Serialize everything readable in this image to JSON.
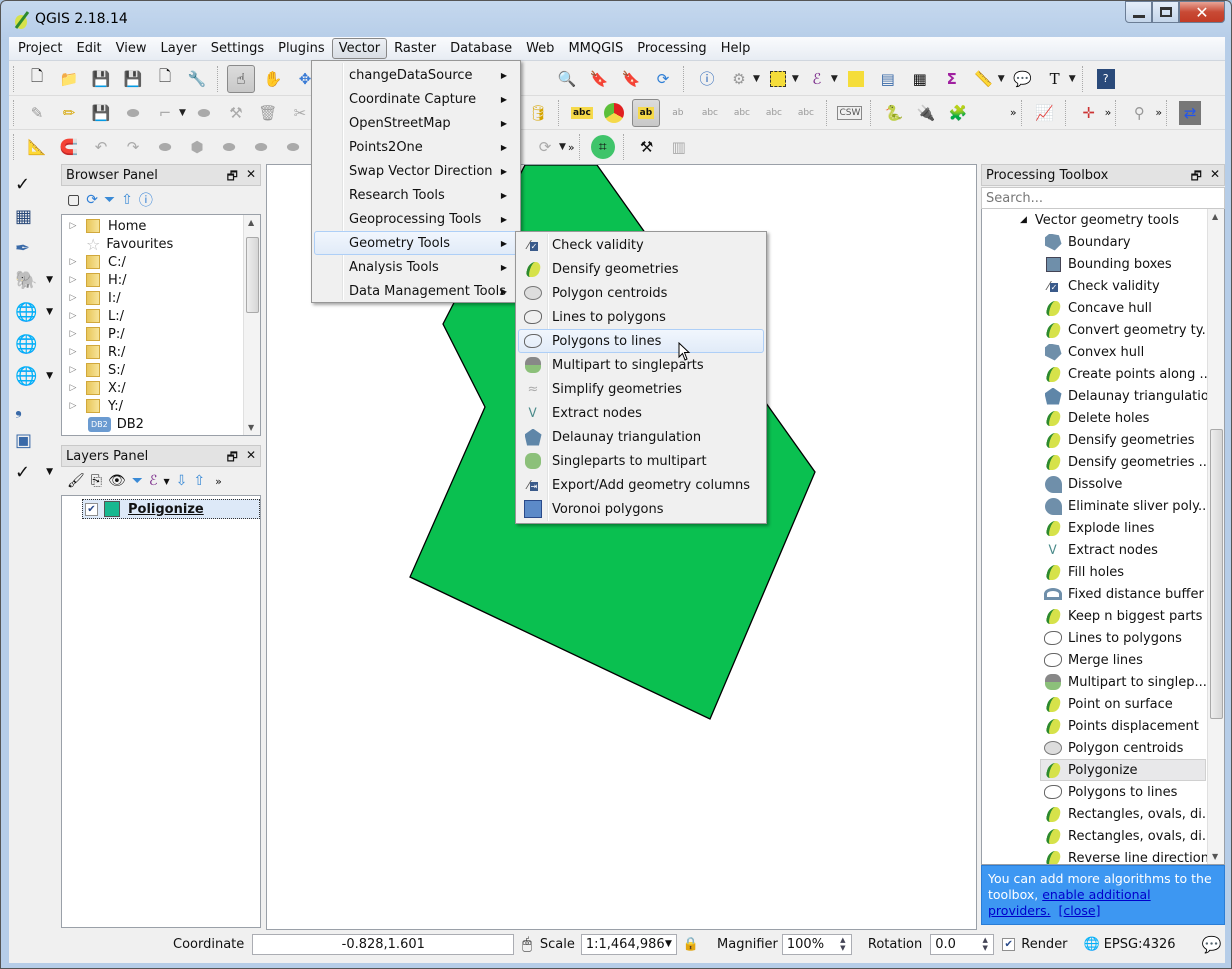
{
  "window": {
    "title": "QGIS 2.18.14",
    "controls": {
      "minimize": "minimize-icon",
      "maximize": "maximize-icon",
      "close": "close-icon"
    }
  },
  "menubar": {
    "items": [
      "Project",
      "Edit",
      "View",
      "Layer",
      "Settings",
      "Plugins",
      "Vector",
      "Raster",
      "Database",
      "Web",
      "MMQGIS",
      "Processing",
      "Help"
    ],
    "active": "Vector"
  },
  "vector_menu": {
    "items": [
      {
        "label": "changeDataSource",
        "submenu": true
      },
      {
        "label": "Coordinate Capture",
        "submenu": true
      },
      {
        "label": "OpenStreetMap",
        "submenu": true
      },
      {
        "label": "Points2One",
        "submenu": true
      },
      {
        "label": "Swap Vector Direction",
        "submenu": true
      },
      {
        "label": "Research Tools",
        "submenu": true
      },
      {
        "label": "Geoprocessing Tools",
        "submenu": true
      },
      {
        "label": "Geometry Tools",
        "submenu": true,
        "highlighted": true
      },
      {
        "label": "Analysis Tools",
        "submenu": true
      },
      {
        "label": "Data Management Tools",
        "submenu": true
      }
    ]
  },
  "geometry_submenu": {
    "items": [
      {
        "label": "Check validity",
        "icon": "check-validity-icon"
      },
      {
        "label": "Densify geometries",
        "icon": "qgis-algorithm-icon"
      },
      {
        "label": "Polygon centroids",
        "icon": "polygon-centroids-icon"
      },
      {
        "label": "Lines to polygons",
        "icon": "lines-to-polygons-icon"
      },
      {
        "label": "Polygons to lines",
        "icon": "polygons-to-lines-icon",
        "highlighted": true
      },
      {
        "label": "Multipart to singleparts",
        "icon": "multipart-icon"
      },
      {
        "label": "Simplify geometries",
        "icon": "simplify-icon"
      },
      {
        "label": "Extract nodes",
        "icon": "extract-nodes-icon"
      },
      {
        "label": "Delaunay triangulation",
        "icon": "delaunay-icon"
      },
      {
        "label": "Singleparts to multipart",
        "icon": "singleparts-icon"
      },
      {
        "label": "Export/Add geometry columns",
        "icon": "export-geometry-icon"
      },
      {
        "label": "Voronoi polygons",
        "icon": "voronoi-icon"
      }
    ]
  },
  "browser_panel": {
    "title": "Browser Panel",
    "items": [
      {
        "label": "Home",
        "type": "folder",
        "expandable": true
      },
      {
        "label": "Favourites",
        "type": "star",
        "expandable": false
      },
      {
        "label": "C:/",
        "type": "folder",
        "expandable": true
      },
      {
        "label": "H:/",
        "type": "folder",
        "expandable": true
      },
      {
        "label": "I:/",
        "type": "folder",
        "expandable": true
      },
      {
        "label": "L:/",
        "type": "folder",
        "expandable": true
      },
      {
        "label": "P:/",
        "type": "folder",
        "expandable": true
      },
      {
        "label": "R:/",
        "type": "folder",
        "expandable": true
      },
      {
        "label": "S:/",
        "type": "folder",
        "expandable": true
      },
      {
        "label": "X:/",
        "type": "folder",
        "expandable": true
      },
      {
        "label": "Y:/",
        "type": "folder",
        "expandable": true
      },
      {
        "label": "DB2",
        "type": "db2",
        "expandable": false
      }
    ],
    "db2_badge": "DB2"
  },
  "layers_panel": {
    "title": "Layers Panel",
    "layers": [
      {
        "name": "Poligonize",
        "visible": true,
        "color": "#17b890"
      }
    ]
  },
  "map": {
    "polygon_fill": "#0ac050",
    "polygon_stroke": "#000000"
  },
  "processing_toolbox": {
    "title": "Processing Toolbox",
    "search_placeholder": "Search...",
    "group": "Vector geometry tools",
    "items": [
      {
        "label": "Boundary",
        "icon": "boundary-icon"
      },
      {
        "label": "Bounding boxes",
        "icon": "bounding-boxes-icon"
      },
      {
        "label": "Check validity",
        "icon": "check-validity-icon"
      },
      {
        "label": "Concave hull",
        "icon": "qgis-algorithm-icon"
      },
      {
        "label": "Convert geometry ty...",
        "icon": "qgis-algorithm-icon"
      },
      {
        "label": "Convex hull",
        "icon": "convex-hull-icon"
      },
      {
        "label": "Create points along ...",
        "icon": "qgis-algorithm-icon"
      },
      {
        "label": "Delaunay triangulation",
        "icon": "delaunay-icon"
      },
      {
        "label": "Delete holes",
        "icon": "qgis-algorithm-icon"
      },
      {
        "label": "Densify geometries",
        "icon": "qgis-algorithm-icon"
      },
      {
        "label": "Densify geometries ...",
        "icon": "qgis-algorithm-icon"
      },
      {
        "label": "Dissolve",
        "icon": "dissolve-icon"
      },
      {
        "label": "Eliminate sliver poly...",
        "icon": "eliminate-icon"
      },
      {
        "label": "Explode lines",
        "icon": "qgis-algorithm-icon"
      },
      {
        "label": "Extract nodes",
        "icon": "extract-nodes-icon"
      },
      {
        "label": "Fill holes",
        "icon": "qgis-algorithm-icon"
      },
      {
        "label": "Fixed distance buffer",
        "icon": "buffer-icon"
      },
      {
        "label": "Keep n biggest parts",
        "icon": "qgis-algorithm-icon"
      },
      {
        "label": "Lines to polygons",
        "icon": "lines-to-polygons-icon"
      },
      {
        "label": "Merge lines",
        "icon": "merge-lines-icon"
      },
      {
        "label": "Multipart to singlep...",
        "icon": "multipart-icon"
      },
      {
        "label": "Point on surface",
        "icon": "qgis-algorithm-icon"
      },
      {
        "label": "Points displacement",
        "icon": "qgis-algorithm-icon"
      },
      {
        "label": "Polygon centroids",
        "icon": "polygon-centroids-icon"
      },
      {
        "label": "Polygonize",
        "icon": "qgis-algorithm-icon",
        "selected": true
      },
      {
        "label": "Polygons to lines",
        "icon": "polygons-to-lines-icon"
      },
      {
        "label": "Rectangles, ovals, di...",
        "icon": "qgis-algorithm-icon"
      },
      {
        "label": "Rectangles, ovals, di...",
        "icon": "qgis-algorithm-icon"
      },
      {
        "label": "Reverse line direction",
        "icon": "qgis-algorithm-icon"
      }
    ],
    "info": {
      "text": "You can add more algorithms to the toolbox, ",
      "link1": "enable additional providers.",
      "link2": "[close]"
    }
  },
  "statusbar": {
    "coordinate_label": "Coordinate",
    "coordinate_value": "-0.828,1.601",
    "scale_label": "Scale",
    "scale_value": "1:1,464,986",
    "magnifier_label": "Magnifier",
    "magnifier_value": "100%",
    "rotation_label": "Rotation",
    "rotation_value": "0.0",
    "render_label": "Render",
    "render_checked": true,
    "crs": "EPSG:4326"
  }
}
